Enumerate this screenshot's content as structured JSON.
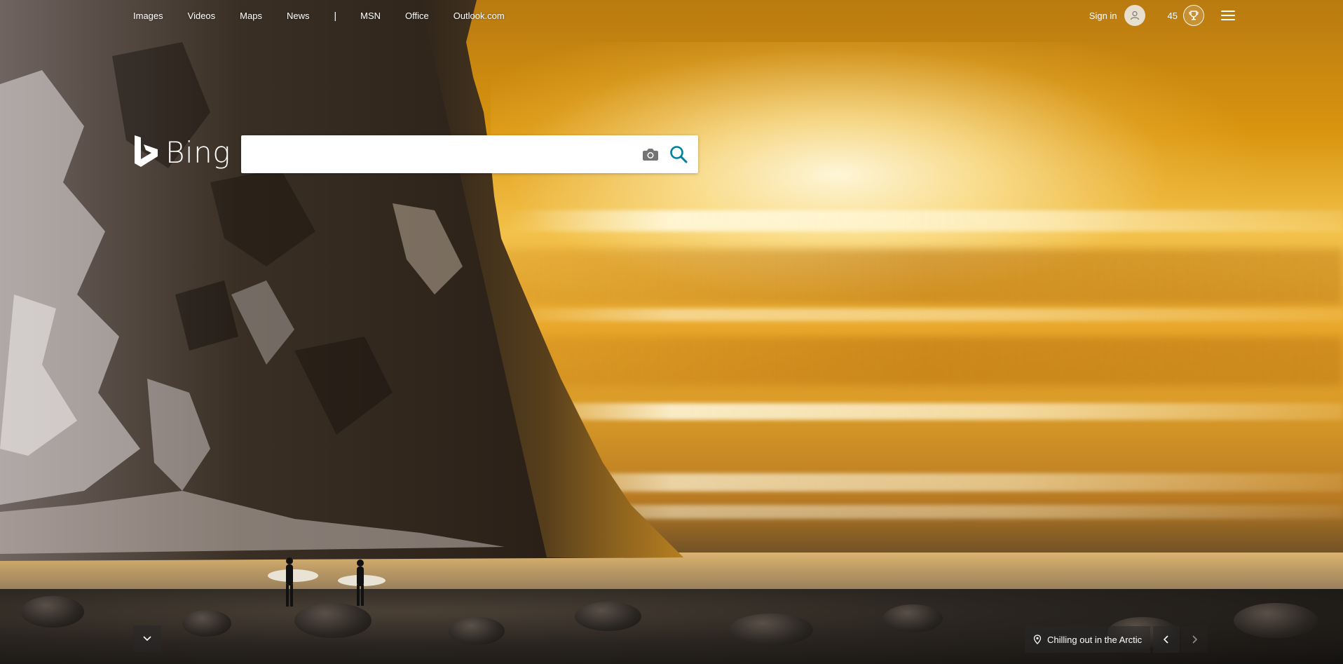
{
  "topnav": {
    "items": [
      "Images",
      "Videos",
      "Maps",
      "News"
    ],
    "separator": "|",
    "items2": [
      "MSN",
      "Office",
      "Outlook.com"
    ]
  },
  "account": {
    "signin_label": "Sign in",
    "points": "45"
  },
  "logo": {
    "text": "Bing"
  },
  "search": {
    "value": "",
    "placeholder": ""
  },
  "image_caption": {
    "text": "Chilling out in the Arctic"
  },
  "icons": {
    "avatar": "user-avatar-icon",
    "rewards": "trophy-icon",
    "menu": "hamburger-menu-icon",
    "visual_search": "camera-icon",
    "search": "search-icon",
    "scroll": "chevron-down-icon",
    "location": "location-pin-icon",
    "prev": "chevron-left-icon",
    "next": "chevron-right-icon"
  },
  "colors": {
    "accent": "#007daa",
    "search_icon": "#00809d"
  }
}
